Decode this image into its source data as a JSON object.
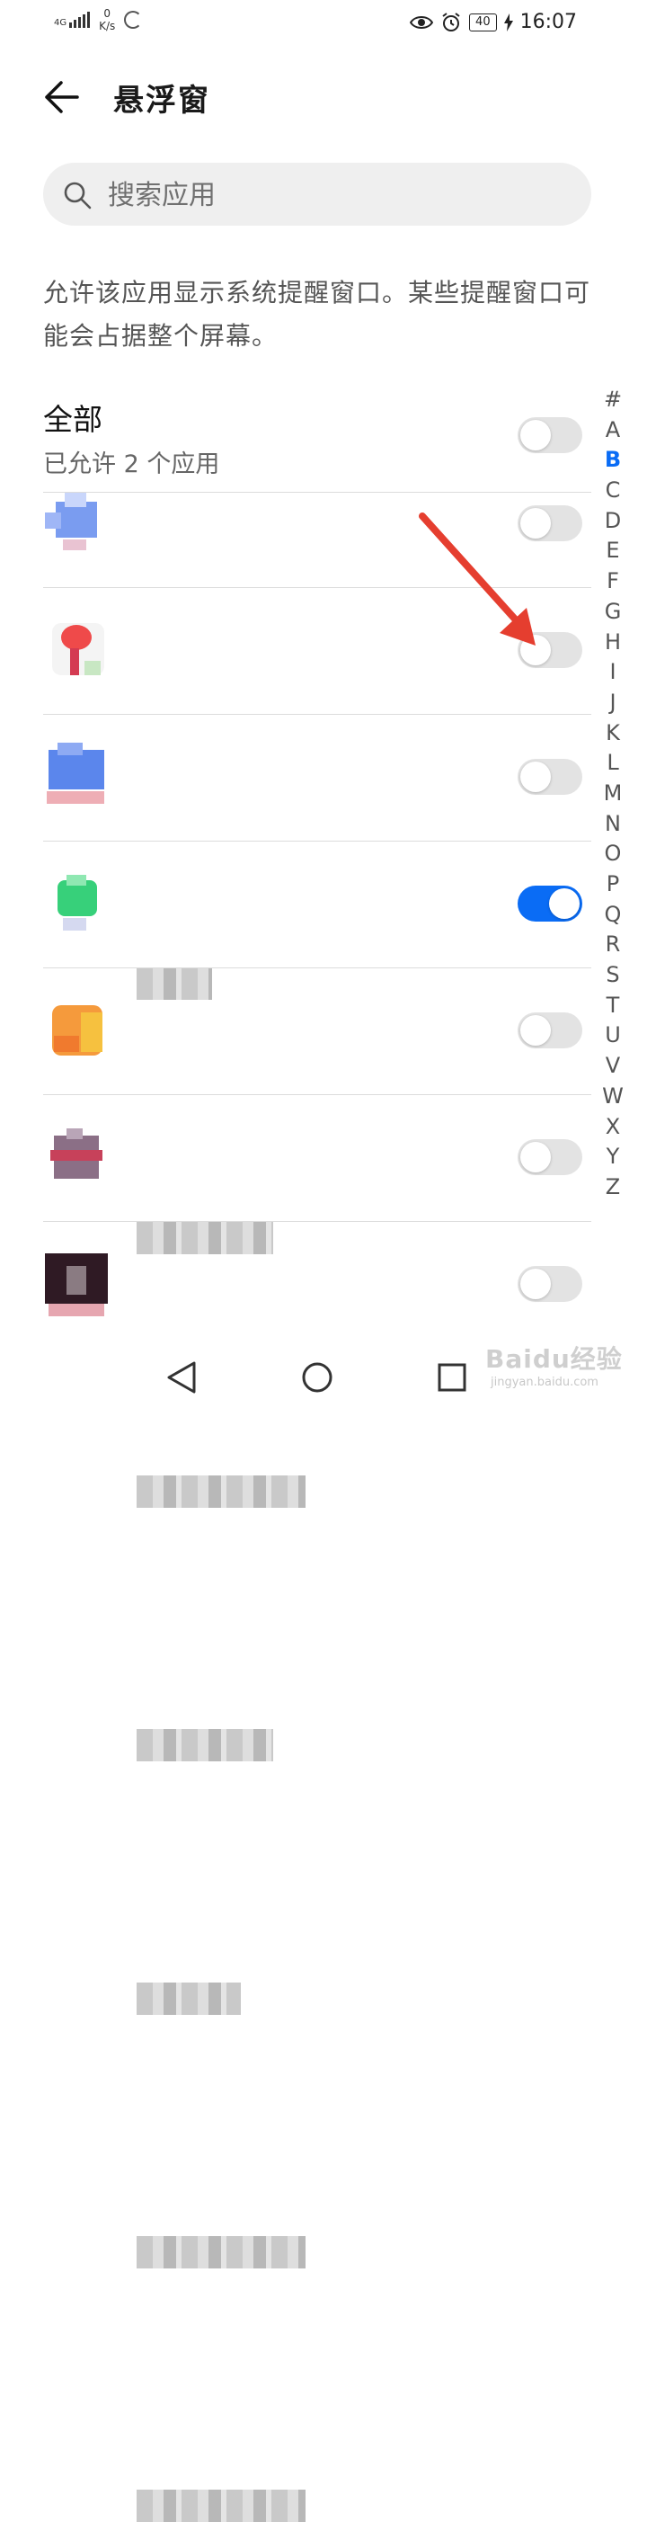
{
  "status_bar": {
    "network": "4G",
    "speed_value": "0",
    "speed_unit": "K/s",
    "battery": "40",
    "time": "16:07"
  },
  "header": {
    "title": "悬浮窗"
  },
  "search": {
    "placeholder": "搜索应用"
  },
  "description": "允许该应用显示系统提醒窗口。某些提醒窗口可能会占据整个屏幕。",
  "all_section": {
    "title": "全部",
    "subtitle": "已允许 2 个应用",
    "enabled": false
  },
  "apps": [
    {
      "name": "",
      "enabled": false
    },
    {
      "name": "",
      "enabled": false
    },
    {
      "name": "",
      "enabled": false
    },
    {
      "name": "",
      "enabled": true
    },
    {
      "name": "",
      "enabled": false
    },
    {
      "name": "",
      "enabled": false
    },
    {
      "name": "",
      "enabled": false
    }
  ],
  "alphabet_index": [
    "#",
    "A",
    "B",
    "C",
    "D",
    "E",
    "F",
    "G",
    "H",
    "I",
    "J",
    "K",
    "L",
    "M",
    "N",
    "O",
    "P",
    "Q",
    "R",
    "S",
    "T",
    "U",
    "V",
    "W",
    "X",
    "Y",
    "Z"
  ],
  "alphabet_active": "B",
  "watermark": {
    "logo": "Baidu经验",
    "url": "jingyan.baidu.com"
  },
  "colors": {
    "accent": "#0a6cf5",
    "annotation_arrow": "#e53e2f",
    "toggle_off": "#e3e3e3"
  }
}
